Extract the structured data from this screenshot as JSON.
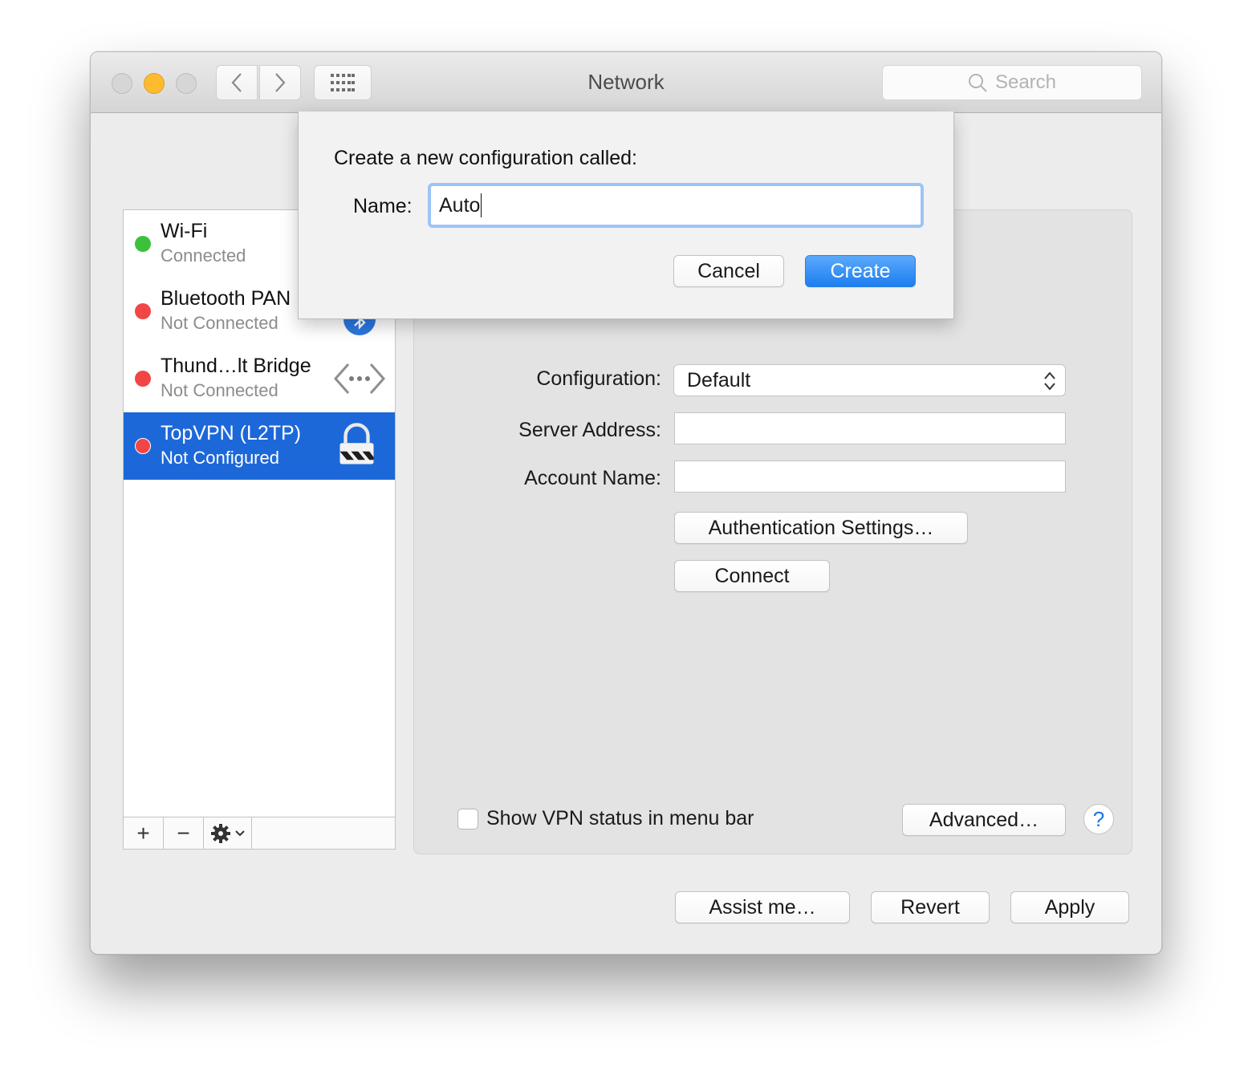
{
  "window": {
    "title": "Network",
    "search_placeholder": "Search"
  },
  "sidebar": {
    "items": [
      {
        "name": "Wi-Fi",
        "status": "Connected",
        "status_color": "#3cc13b",
        "icon": "wifi-icon"
      },
      {
        "name": "Bluetooth PAN",
        "status": "Not Connected",
        "status_color": "#f24646",
        "icon": "bluetooth-icon"
      },
      {
        "name": "Thund…lt Bridge",
        "status": "Not Connected",
        "status_color": "#f24646",
        "icon": "thunderbolt-bridge-icon"
      },
      {
        "name": "TopVPN (L2TP)",
        "status": "Not Configured",
        "status_color": "#f24646",
        "icon": "vpn-lock-icon",
        "selected": true
      }
    ],
    "add_label": "+",
    "remove_label": "−"
  },
  "vpn": {
    "configuration_label": "Configuration:",
    "configuration_value": "Default",
    "server_address_label": "Server Address:",
    "server_address_value": "",
    "account_name_label": "Account Name:",
    "account_name_value": "",
    "auth_settings_label": "Authentication Settings…",
    "connect_label": "Connect",
    "show_status_label": "Show VPN status in menu bar",
    "show_status_checked": false,
    "advanced_label": "Advanced…",
    "help_label": "?"
  },
  "footer": {
    "assist_label": "Assist me…",
    "revert_label": "Revert",
    "apply_label": "Apply"
  },
  "sheet": {
    "title": "Create a new configuration called:",
    "name_label": "Name:",
    "name_value": "Auto",
    "cancel_label": "Cancel",
    "create_label": "Create"
  },
  "colors": {
    "accent": "#1c7ef0",
    "selection": "#1d68d9"
  }
}
